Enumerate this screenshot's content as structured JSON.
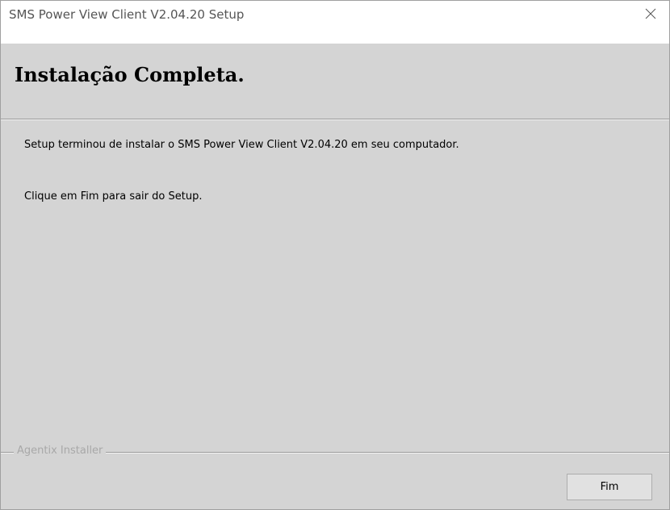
{
  "window": {
    "title": "SMS Power View Client V2.04.20 Setup",
    "close_icon": "close-icon"
  },
  "header": {
    "title": "Instalação Completa."
  },
  "body": {
    "paragraph1": "Setup terminou de instalar o SMS Power View Client V2.04.20 em seu computador.",
    "paragraph2": "Clique em Fim para sair do Setup."
  },
  "footer": {
    "brand": "Agentix Installer",
    "finish_label": "Fim"
  },
  "colors": {
    "titlebar_bg": "#ffffff",
    "window_bg": "#d4d4d4",
    "button_bg": "#e1e1e1",
    "brand_text": "#a8a8a8"
  }
}
